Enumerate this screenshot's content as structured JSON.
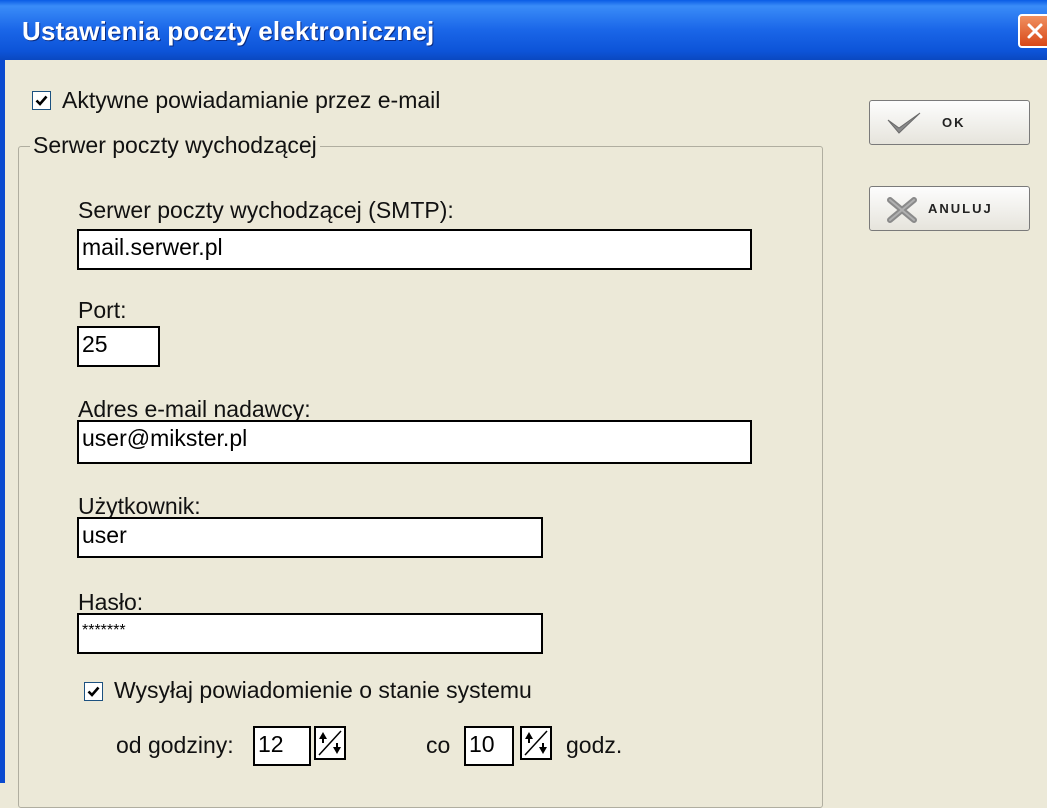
{
  "window": {
    "title": "Ustawienia poczty elektronicznej"
  },
  "notify": {
    "label": "Aktywne powiadamianie przez e-mail",
    "checked": true
  },
  "group": {
    "legend": "Serwer poczty wychodzącej"
  },
  "smtp": {
    "label": "Serwer poczty wychodzącej (SMTP):",
    "value": "mail.serwer.pl"
  },
  "port": {
    "label": "Port:",
    "value": "25"
  },
  "sender": {
    "label": "Adres e-mail nadawcy:",
    "value": "user@mikster.pl"
  },
  "user": {
    "label": "Użytkownik:",
    "value": "user"
  },
  "password": {
    "label": "Hasło:",
    "value": "*******"
  },
  "status": {
    "label": "Wysyłaj powiadomienie o stanie systemu",
    "checked": true
  },
  "schedule": {
    "from_label": "od godziny:",
    "from_value": "12",
    "every_label": "co",
    "every_value": "10",
    "unit_label": "godz."
  },
  "buttons": {
    "ok_label": "OK",
    "cancel_label": "ANULUJ"
  },
  "icons": {
    "close": "close-icon",
    "ok": "checkmark-icon",
    "cancel": "cross-icon",
    "spin": "spin-arrows-icon"
  }
}
